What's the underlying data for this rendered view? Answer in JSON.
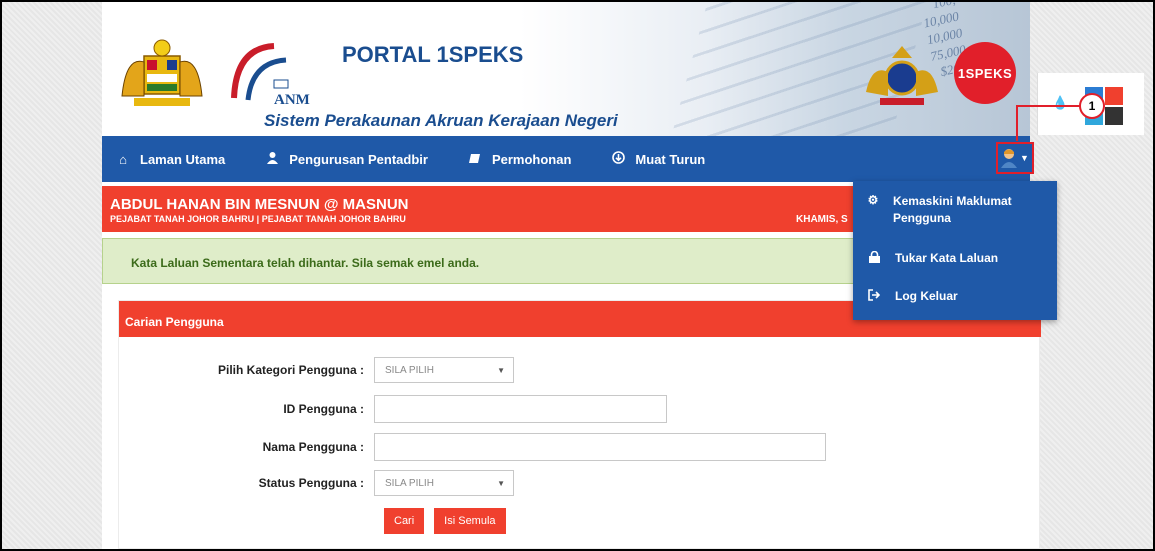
{
  "header": {
    "portal_title": "PORTAL 1SPEKS",
    "subtitle": "Sistem Perakaunan Akruan Kerajaan Negeri",
    "anm_logo_text": "ANM",
    "brand_logo_text": "1SPEKS",
    "deco_numbers": [
      "100,",
      "10,000",
      "10,000",
      "75,000",
      "$205,"
    ]
  },
  "nav": {
    "items": [
      {
        "label": "Laman Utama",
        "icon": "home-icon"
      },
      {
        "label": "Pengurusan Pentadbir",
        "icon": "user-icon"
      },
      {
        "label": "Permohonan",
        "icon": "book-icon"
      },
      {
        "label": "Muat Turun",
        "icon": "download-circle-icon"
      }
    ],
    "user_button_icon": "user-avatar-icon"
  },
  "user": {
    "name": "ABDUL HANAN BIN MESNUN @ MASNUN",
    "office": "PEJABAT TANAH JOHOR BAHRU | PEJABAT TANAH JOHOR BAHRU",
    "date_partial": "KHAMIS, S"
  },
  "alert": {
    "message": "Kata Laluan Sementara telah dihantar. Sila semak emel anda."
  },
  "search": {
    "title": "Carian Pengguna",
    "fields": {
      "category_label": "Pilih Kategori Pengguna :",
      "category_value": "SILA PILIH",
      "id_label": "ID Pengguna :",
      "id_value": "",
      "name_label": "Nama Pengguna :",
      "name_value": "",
      "status_label": "Status Pengguna :",
      "status_value": "SILA PILIH"
    },
    "buttons": {
      "search": "Cari",
      "reset": "Isi Semula"
    }
  },
  "user_menu": {
    "items": [
      {
        "label": "Kemaskini Maklumat Pengguna",
        "icon": "gear-icon"
      },
      {
        "label": "Tukar Kata Laluan",
        "icon": "lock-icon"
      },
      {
        "label": "Log Keluar",
        "icon": "logout-icon"
      }
    ]
  },
  "callout": {
    "number": "1"
  },
  "colors": {
    "nav_blue": "#1f59a8",
    "accent_red": "#f0402e",
    "alert_green_bg": "#dfedc9",
    "alert_green_text": "#3c6b1a"
  }
}
